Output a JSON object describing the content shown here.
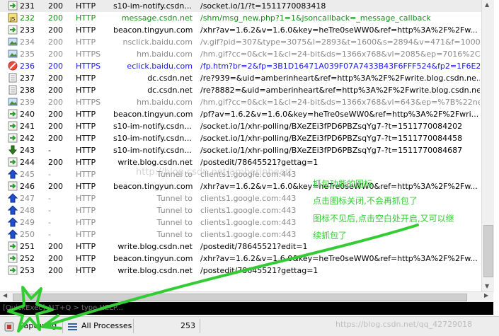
{
  "sessions": [
    {
      "num": "231",
      "result": "200",
      "protocol": "HTTP",
      "host": "s10-im-notify.csdn....",
      "url": "/socket.io/1/?t=1511770083418",
      "icon": "arrow-icon",
      "style": "normal"
    },
    {
      "num": "232",
      "result": "200",
      "protocol": "HTTP",
      "host": "message.csdn.net",
      "url": "/shm/msg_new.php?1=1&jsoncallback=_message_callback",
      "icon": "js-icon",
      "style": "green"
    },
    {
      "num": "233",
      "result": "200",
      "protocol": "HTTP",
      "host": "beacon.tingyun.com",
      "url": "/xhr?av=1.6.2&v=1.6.0&key=heTre0seWW0&ref=http%3A%2F%2Fw...",
      "icon": "arrow-icon",
      "style": "normal"
    },
    {
      "num": "234",
      "result": "200",
      "protocol": "HTTP",
      "host": "nsclick.baidu.com",
      "url": "/v.gif?pid=307&type=3075&l=2893&t=1600&s=2894&v=471&f=1000&...",
      "icon": "image-icon",
      "style": "gray"
    },
    {
      "num": "235",
      "result": "200",
      "protocol": "HTTPS",
      "host": "hm.baidu.com",
      "url": "/hm.gif?cc=0&ck=1&cl=24-bit&ds=1366x768&vl=2085&ep=7016%2C4...",
      "icon": "image-icon",
      "style": "gray"
    },
    {
      "num": "236",
      "result": "200",
      "protocol": "HTTPS",
      "host": "eclick.baidu.com",
      "url": "/fp.htm?br=2&fp=3B1D16471A039F07A7433B43F6FFF524&fp2=1F6E2...",
      "icon": "blocked-icon",
      "style": "blue"
    },
    {
      "num": "237",
      "result": "200",
      "protocol": "HTTP",
      "host": "dc.csdn.net",
      "url": "/re?939=&uid=amberinheart&ref=http%3A%2F%2Fwrite.blog.csdn.ne...",
      "icon": "document-icon",
      "style": "normal"
    },
    {
      "num": "238",
      "result": "200",
      "protocol": "HTTP",
      "host": "dc.csdn.net",
      "url": "/re?8882=&uid=amberinheart&ref=http%3A%2F%2Fwrite.blog.csdn.net...",
      "icon": "document-icon",
      "style": "normal"
    },
    {
      "num": "239",
      "result": "200",
      "protocol": "HTTPS",
      "host": "hm.baidu.com",
      "url": "/hm.gif?cc=0&ck=1&cl=24-bit&ds=1366x768&vl=643&ep=%7B%22net...",
      "icon": "image-icon",
      "style": "gray"
    },
    {
      "num": "240",
      "result": "200",
      "protocol": "HTTP",
      "host": "beacon.tingyun.com",
      "url": "/pf?av=1.6.2&v=1.6.0&key=heTre0seWW0&ref=http%3A%2F%2Fwri...",
      "icon": "arrow-icon",
      "style": "normal"
    },
    {
      "num": "241",
      "result": "200",
      "protocol": "HTTP",
      "host": "s10-im-notify.csdn....",
      "url": "/socket.io/1/xhr-polling/BXeZEi3fPD6PBZsqYg7-?t=1511770084202",
      "icon": "arrow-icon",
      "style": "normal"
    },
    {
      "num": "242",
      "result": "200",
      "protocol": "HTTP",
      "host": "s10-im-notify.csdn....",
      "url": "/socket.io/1/xhr-polling/BXeZEi3fPD6PBZsqYg7-?t=1511770084458",
      "icon": "arrow-icon",
      "style": "normal"
    },
    {
      "num": "243",
      "result": "-",
      "protocol": "HTTP",
      "host": "s10-im-notify.csdn....",
      "url": "/socket.io/1/xhr-polling/BXeZEi3fPD6PBZsqYg7-?t=1511770084687",
      "icon": "download-icon",
      "style": "normal"
    },
    {
      "num": "244",
      "result": "200",
      "protocol": "HTTP",
      "host": "write.blog.csdn.net",
      "url": "/postedit/78645521?gettag=1",
      "icon": "arrow-icon",
      "style": "normal"
    },
    {
      "num": "245",
      "result": "-",
      "protocol": "HTTP",
      "host": "Tunnel to",
      "url": "clients1.google.com:443",
      "icon": "upload-icon",
      "style": "gray"
    },
    {
      "num": "246",
      "result": "200",
      "protocol": "HTTP",
      "host": "beacon.tingyun.com",
      "url": "/xhr?av=1.6.2&v=1.6.0&key=heTre0seWW0&ref=http%3A%2F%2Fw...",
      "icon": "arrow-icon",
      "style": "normal"
    },
    {
      "num": "247",
      "result": "-",
      "protocol": "HTTP",
      "host": "Tunnel to",
      "url": "clients1.google.com:443",
      "icon": "upload-icon",
      "style": "gray"
    },
    {
      "num": "248",
      "result": "-",
      "protocol": "HTTP",
      "host": "Tunnel to",
      "url": "clients1.google.com:443",
      "icon": "upload-icon",
      "style": "gray"
    },
    {
      "num": "249",
      "result": "-",
      "protocol": "HTTP",
      "host": "Tunnel to",
      "url": "clients1.google.com:443",
      "icon": "upload-icon",
      "style": "gray"
    },
    {
      "num": "250",
      "result": "-",
      "protocol": "HTTP",
      "host": "Tunnel to",
      "url": "clients1.google.com:443",
      "icon": "upload-icon",
      "style": "gray"
    },
    {
      "num": "251",
      "result": "200",
      "protocol": "HTTP",
      "host": "write.blog.csdn.net",
      "url": "/postedit/78645521?edit=1",
      "icon": "arrow-icon",
      "style": "normal"
    },
    {
      "num": "252",
      "result": "200",
      "protocol": "HTTP",
      "host": "beacon.tingyun.com",
      "url": "/xhr?av=1.6.2&v=1.6.0&key=heTre0seWW0&ref=http%3A%2F%2Fw...",
      "icon": "arrow-icon",
      "style": "normal"
    },
    {
      "num": "253",
      "result": "200",
      "protocol": "HTTP",
      "host": "write.blog.csdn.net",
      "url": "/postedit/78645521?gettag=1",
      "icon": "arrow-icon",
      "style": "normal"
    }
  ],
  "quickexec": {
    "placeholder": "[QuickExec] ALT+Q > type HELP..."
  },
  "statusbar": {
    "capturing": "Capturing",
    "processes": "All Processes",
    "count": "253"
  },
  "annotations": {
    "line1": "抓包功能的图标,",
    "line2": "点击图标关闭,不会再抓包了",
    "line3": "图标不见后,点击空白处开启,又可以继",
    "line4": "续抓包了"
  },
  "watermarks": {
    "top": "http://blog.csdn.net/amberinheart",
    "bottom": "https://blog.csdn.net/qq_42729018"
  },
  "colors": {
    "annotation": "#33cc33",
    "quickexec_bg": "#000000",
    "link_blue": "#1a1aee",
    "muted_gray": "#8a8a8a",
    "green_text": "#1a8a1a"
  }
}
